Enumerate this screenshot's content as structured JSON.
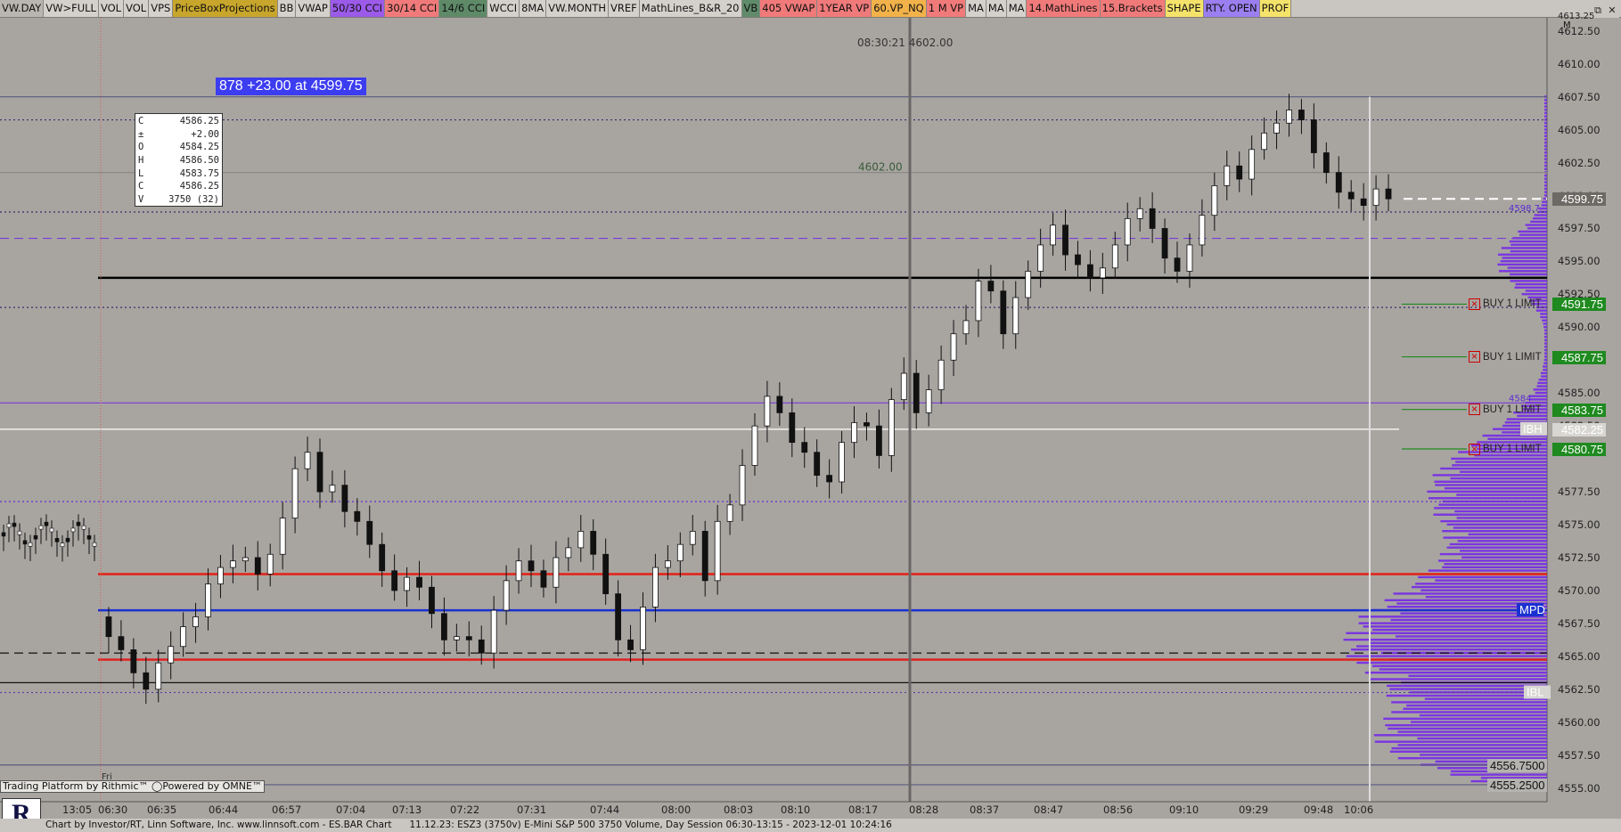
{
  "toolbar": {
    "buttons": [
      {
        "label": "VW.DAY",
        "bg": "#b9b6b1"
      },
      {
        "label": "VW>FULL",
        "bg": "#d4d1cc"
      },
      {
        "label": "VOL",
        "bg": "#d4d1cc"
      },
      {
        "label": "VOL",
        "bg": "#d4d1cc"
      },
      {
        "label": "VPS",
        "bg": "#d4d1cc"
      },
      {
        "label": "PriceBoxProjections",
        "bg": "#c8a62c"
      },
      {
        "label": "BB",
        "bg": "#d4d1cc"
      },
      {
        "label": "VWAP",
        "bg": "#d4d1cc"
      },
      {
        "label": "50/30 CCI",
        "bg": "#9b5ae8"
      },
      {
        "label": "30/14 CCI",
        "bg": "#f07a7a"
      },
      {
        "label": "14/6 CCI",
        "bg": "#5e8a68"
      },
      {
        "label": "WCCI",
        "bg": "#d4d1cc"
      },
      {
        "label": "8MA",
        "bg": "#d4d1cc"
      },
      {
        "label": "VW.MONTH",
        "bg": "#d4d1cc"
      },
      {
        "label": "VREF",
        "bg": "#d4d1cc"
      },
      {
        "label": "MathLines_B&R_20",
        "bg": "#d4d1cc"
      },
      {
        "label": "VB",
        "bg": "#5f8b6a"
      },
      {
        "label": "405 VWAP",
        "bg": "#f07a7a"
      },
      {
        "label": "1YEAR VP",
        "bg": "#f07a7a"
      },
      {
        "label": "60.VP_NQ",
        "bg": "#f2b24a"
      },
      {
        "label": "1 M VP",
        "bg": "#f07a7a"
      },
      {
        "label": "MA",
        "bg": "#d4d1cc"
      },
      {
        "label": "MA",
        "bg": "#d4d1cc"
      },
      {
        "label": "MA",
        "bg": "#d4d1cc"
      },
      {
        "label": "14.MathLines",
        "bg": "#f07a7a"
      },
      {
        "label": "15.Brackets",
        "bg": "#f07a7a"
      },
      {
        "label": "SHAPE",
        "bg": "#f5e26a"
      },
      {
        "label": "RTY. OPEN",
        "bg": "#9b7ef0"
      },
      {
        "label": "PROF",
        "bg": "#f5e26a"
      }
    ],
    "window_icons": [
      "restore-icon",
      "close-icon"
    ],
    "window_glyphs": [
      "⧉",
      "✕"
    ]
  },
  "cursor": {
    "time": "08:30:21",
    "price": "4602.00"
  },
  "banner": {
    "text": "878  +23.00 at 4599.75"
  },
  "quote_box": [
    {
      "k": "C",
      "v": "4586.25"
    },
    {
      "k": "±",
      "v": "+2.00"
    },
    {
      "k": "O",
      "v": "4584.25"
    },
    {
      "k": "H",
      "v": "4586.50"
    },
    {
      "k": "L",
      "v": "4583.75"
    },
    {
      "k": "C",
      "v": "4586.25"
    },
    {
      "k": "V",
      "v": "3750 (32)"
    }
  ],
  "chart_labels": {
    "mid_price": "4602.00",
    "level_4598": "4598.7",
    "level_4584": "4584",
    "ibh": "IBH",
    "ibl": "IBL",
    "mpd": "MPD",
    "axis_m": "M",
    "day_label": "Fri"
  },
  "price_axis": {
    "labels": [
      "4612.50",
      "4610.00",
      "4607.50",
      "4605.00",
      "4602.50",
      "4600.00",
      "4597.50",
      "4595.00",
      "4592.50",
      "4590.00",
      "4587.50",
      "4585.00",
      "4582.50",
      "4577.50",
      "4575.00",
      "4572.50",
      "4570.00",
      "4567.50",
      "4565.00",
      "4562.50",
      "4560.00",
      "4557.50",
      "4555.00"
    ],
    "values": [
      4612.5,
      4610,
      4607.5,
      4605,
      4602.5,
      4600,
      4597.5,
      4595,
      4592.5,
      4590,
      4587.5,
      4585,
      4582.5,
      4577.5,
      4575,
      4572.5,
      4570,
      4567.5,
      4565,
      4562.5,
      4560,
      4557.5,
      4555
    ],
    "top_clip": "4613.25"
  },
  "price_tags": [
    {
      "text": "4599.75",
      "value": 4599.75,
      "bg": "#6d6a66",
      "fg": "#fff"
    },
    {
      "text": "4591.75",
      "value": 4591.75,
      "bg": "#1f8a1f",
      "fg": "#fff"
    },
    {
      "text": "4587.75",
      "value": 4587.75,
      "bg": "#1f8a1f",
      "fg": "#fff"
    },
    {
      "text": "4583.75",
      "value": 4583.75,
      "bg": "#1f8a1f",
      "fg": "#fff"
    },
    {
      "text": "4582.25",
      "value": 4582.25,
      "bg": "#d8d6d2",
      "fg": "#fff"
    },
    {
      "text": "4580.75",
      "value": 4580.75,
      "bg": "#1f8a1f",
      "fg": "#fff"
    },
    {
      "text": "4556.7500",
      "value": 4556.75,
      "bg": "#b5b3af",
      "fg": "#111"
    },
    {
      "text": "4555.2500",
      "value": 4555.25,
      "bg": "#b5b3af",
      "fg": "#111"
    }
  ],
  "orders": [
    {
      "label": "BUY 1 LIMIT",
      "value": 4591.75
    },
    {
      "label": "BUY 1 LIMIT",
      "value": 4587.75
    },
    {
      "label": "BUY 1 LIMIT",
      "value": 4583.75
    },
    {
      "label": "BUY 1 LIMIT",
      "value": 4580.75
    }
  ],
  "time_axis": {
    "labels": [
      "13:05",
      "06:30",
      "06:35",
      "06:44",
      "06:57",
      "07:04",
      "07:13",
      "07:22",
      "07:31",
      "07:44",
      "08:00",
      "08:03",
      "08:10",
      "08:17",
      "08:28",
      "08:37",
      "08:47",
      "08:56",
      "09:10",
      "09:29",
      "09:48",
      "10:06"
    ]
  },
  "footer": {
    "credit": "Chart by Investor/RT, Linn Software, Inc. www.linnsoft.com - ES.BAR Chart",
    "status": "11.12.23: ESZ3 (3750v) E-Mini S&P 500 3750 Volume, Day Session 06:30-13:15 - 2023-12-01 10:24:16",
    "rithmic": "Trading Platform by Rithmic™  ◯Powered by OMNE™",
    "logo_letter": "R"
  },
  "chart_data": {
    "type": "candlestick",
    "instrument": "ESZ3",
    "ylim": [
      4554.5,
      4613.5
    ],
    "last": 4599.75,
    "day_high": 4607.5,
    "day_low": 4562.25,
    "levels": [
      {
        "value": 4607.5,
        "style": "solid",
        "color": "#5a5a80"
      },
      {
        "value": 4605.75,
        "style": "dotted",
        "color": "#3a2a6a"
      },
      {
        "value": 4601.75,
        "style": "solid",
        "color": "#8a8884"
      },
      {
        "value": 4598.75,
        "style": "dotted",
        "color": "#3a2a6a"
      },
      {
        "value": 4596.75,
        "style": "dashed",
        "color": "#7a3ad8"
      },
      {
        "value": 4593.75,
        "style": "solid",
        "color": "#000"
      },
      {
        "value": 4591.5,
        "style": "dotted",
        "color": "#3a2a6a"
      },
      {
        "value": 4584.25,
        "style": "solid",
        "color": "#7a3ad8"
      },
      {
        "value": 4582.25,
        "style": "solid",
        "color": "#fff"
      },
      {
        "value": 4576.75,
        "style": "dotted",
        "color": "#6a2ad0"
      },
      {
        "value": 4571.25,
        "style": "solid",
        "color": "#e0a020"
      },
      {
        "value": 4571.25,
        "style": "solid",
        "color": "#e02020"
      },
      {
        "value": 4568.5,
        "style": "solid",
        "color": "#1a30d0"
      },
      {
        "value": 4565.25,
        "style": "dashed",
        "color": "#111"
      },
      {
        "value": 4564.75,
        "style": "solid",
        "color": "#e02020"
      },
      {
        "value": 4563.0,
        "style": "solid",
        "color": "#111"
      },
      {
        "value": 4562.25,
        "style": "dotted",
        "color": "#5a3aa0"
      },
      {
        "value": 4556.75,
        "style": "solid",
        "color": "#5a5a80"
      },
      {
        "value": 4555.25,
        "style": "solid",
        "color": "#5a5a80"
      }
    ],
    "closes": [
      4566.5,
      4565.5,
      4563.75,
      4562.5,
      4564.5,
      4565.75,
      4567.25,
      4568,
      4570.5,
      4571.75,
      4572.25,
      4572.5,
      4571.25,
      4572.75,
      4575.5,
      4579.25,
      4580.5,
      4577.5,
      4578,
      4576,
      4575.25,
      4573.5,
      4571.5,
      4570,
      4571,
      4570.25,
      4568.25,
      4566.25,
      4566.5,
      4566.25,
      4565.25,
      4568.5,
      4570.75,
      4572.25,
      4571.5,
      4570.25,
      4572.5,
      4573.25,
      4574.5,
      4572.75,
      4569.75,
      4566.25,
      4565.5,
      4568.75,
      4571.75,
      4572.25,
      4573.5,
      4574.5,
      4570.75,
      4575.25,
      4576.5,
      4579.5,
      4582.5,
      4584.75,
      4583.5,
      4581.25,
      4580.5,
      4578.75,
      4578.25,
      4581.25,
      4582.75,
      4582.5,
      4580.25,
      4584.5,
      4586.5,
      4583.5,
      4585.25,
      4587.5,
      4589.5,
      4590.5,
      4593.5,
      4592.75,
      4589.5,
      4592.25,
      4594.25,
      4596.25,
      4597.75,
      4595.5,
      4594.75,
      4593.75,
      4594.5,
      4596.25,
      4598.25,
      4599,
      4597.5,
      4595.25,
      4594.25,
      4596.25,
      4598.5,
      4600.75,
      4602.25,
      4601.25,
      4603.5,
      4604.75,
      4605.5,
      4606.5,
      4605.75,
      4603.25,
      4601.75,
      4600.25,
      4599.75,
      4599.25,
      4600.5,
      4599.75
    ]
  }
}
